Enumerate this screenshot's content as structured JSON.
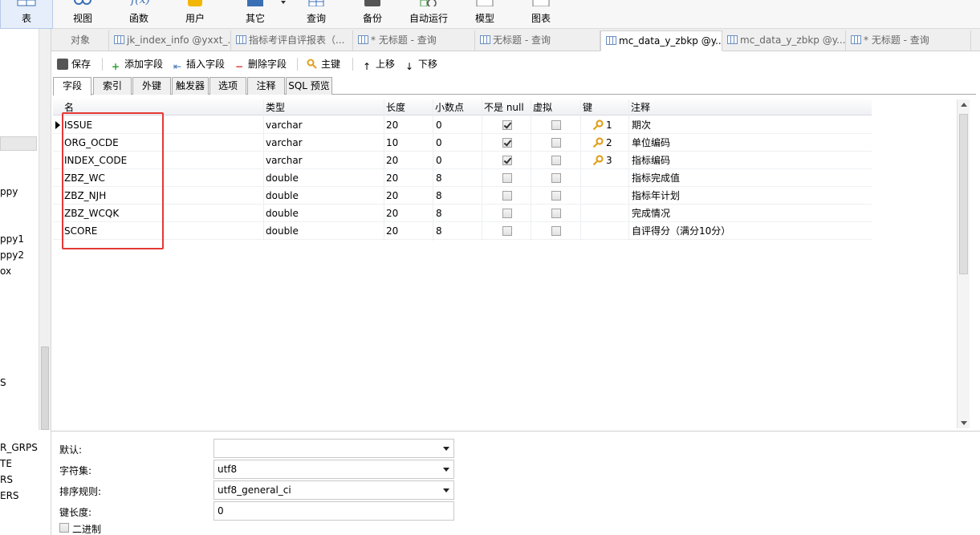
{
  "toolbar": {
    "items": [
      {
        "label": "表",
        "icon": "table-icon"
      },
      {
        "label": "视图",
        "icon": "view-icon"
      },
      {
        "label": "函数",
        "icon": "function-icon"
      },
      {
        "label": "用户",
        "icon": "user-icon"
      },
      {
        "label": "其它",
        "icon": "other-icon"
      },
      {
        "label": "查询",
        "icon": "query-icon"
      },
      {
        "label": "备份",
        "icon": "backup-icon"
      },
      {
        "label": "自动运行",
        "icon": "automation-icon"
      },
      {
        "label": "模型",
        "icon": "model-icon"
      },
      {
        "label": "图表",
        "icon": "chart-icon"
      }
    ]
  },
  "sidebar": {
    "items": [
      "ppy",
      "ppy1",
      "ppy2",
      "ox",
      "S",
      "R_GRPS",
      "TE",
      "RS",
      "ERS"
    ]
  },
  "tabs": [
    {
      "label": "对象"
    },
    {
      "label": "jk_index_info @yxxt_..."
    },
    {
      "label": "指标考评自评报表（..."
    },
    {
      "label": "* 无标题 - 查询"
    },
    {
      "label": "无标题 - 查询"
    },
    {
      "label": "mc_data_y_zbkp @y..."
    },
    {
      "label": "mc_data_y_zbkp @y..."
    },
    {
      "label": "* 无标题 - 查询"
    }
  ],
  "editor_toolbar": {
    "save": "保存",
    "add_field": "添加字段",
    "insert_field": "插入字段",
    "delete_field": "删除字段",
    "primary_key": "主键",
    "move_up": "上移",
    "move_down": "下移"
  },
  "subtabs": [
    "字段",
    "索引",
    "外键",
    "触发器",
    "选项",
    "注释",
    "SQL 预览"
  ],
  "grid": {
    "headers": {
      "name": "名",
      "type": "类型",
      "length": "长度",
      "decimals": "小数点",
      "not_null": "不是 null",
      "virtual": "虚拟",
      "key": "键",
      "comment": "注释"
    },
    "rows": [
      {
        "name": "ISSUE",
        "type": "varchar",
        "length": "20",
        "decimals": "0",
        "not_null": true,
        "virtual": false,
        "key": "1",
        "comment": "期次"
      },
      {
        "name": "ORG_OCDE",
        "type": "varchar",
        "length": "10",
        "decimals": "0",
        "not_null": true,
        "virtual": false,
        "key": "2",
        "comment": "单位编码"
      },
      {
        "name": "INDEX_CODE",
        "type": "varchar",
        "length": "20",
        "decimals": "0",
        "not_null": true,
        "virtual": false,
        "key": "3",
        "comment": "指标编码"
      },
      {
        "name": "ZBZ_WC",
        "type": "double",
        "length": "20",
        "decimals": "8",
        "not_null": false,
        "virtual": false,
        "key": "",
        "comment": "指标完成值"
      },
      {
        "name": "ZBZ_NJH",
        "type": "double",
        "length": "20",
        "decimals": "8",
        "not_null": false,
        "virtual": false,
        "key": "",
        "comment": "指标年计划"
      },
      {
        "name": "ZBZ_WCQK",
        "type": "double",
        "length": "20",
        "decimals": "8",
        "not_null": false,
        "virtual": false,
        "key": "",
        "comment": "完成情况"
      },
      {
        "name": "SCORE",
        "type": "double",
        "length": "20",
        "decimals": "8",
        "not_null": false,
        "virtual": false,
        "key": "",
        "comment": "自评得分（满分10分）"
      }
    ]
  },
  "props": {
    "default_label": "默认:",
    "default_value": "",
    "charset_label": "字符集:",
    "charset_value": "utf8",
    "collation_label": "排序规则:",
    "collation_value": "utf8_general_ci",
    "keylen_label": "键长度:",
    "keylen_value": "0",
    "binary_label": "二进制"
  },
  "colors": {
    "highlight_box": "#e53935",
    "key_icon": "#e0a020",
    "tab_icon": "#6a8fc2"
  }
}
